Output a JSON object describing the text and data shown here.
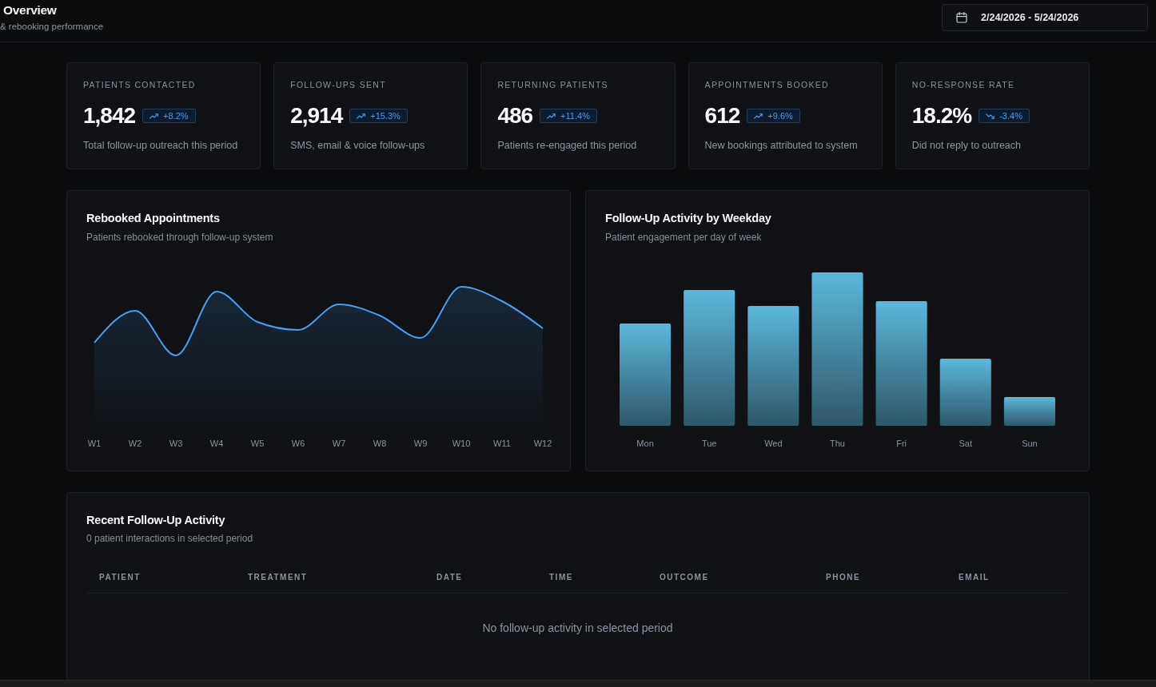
{
  "header": {
    "title": "Overview",
    "subtitle": "& rebooking performance",
    "date_range": "2/24/2026 - 5/24/2026"
  },
  "kpis": [
    {
      "label": "PATIENTS CONTACTED",
      "value": "1,842",
      "change": "+8.2%",
      "trend_up": true,
      "description": "Total follow-up outreach this period"
    },
    {
      "label": "FOLLOW-UPS SENT",
      "value": "2,914",
      "change": "+15.3%",
      "trend_up": true,
      "description": "SMS, email & voice follow-ups"
    },
    {
      "label": "RETURNING PATIENTS",
      "value": "486",
      "change": "+11.4%",
      "trend_up": true,
      "description": "Patients re-engaged this period"
    },
    {
      "label": "APPOINTMENTS BOOKED",
      "value": "612",
      "change": "+9.6%",
      "trend_up": true,
      "description": "New bookings attributed to system"
    },
    {
      "label": "NO-RESPONSE RATE",
      "value": "18.2%",
      "change": "-3.4%",
      "trend_up": false,
      "description": "Did not reply to outreach"
    }
  ],
  "charts": [
    {
      "kind": "area",
      "title": "Rebooked Appointments",
      "subtitle": "Patients rebooked through follow-up system",
      "axis_labels": [
        "W1",
        "W2",
        "W3",
        "W4",
        "W5",
        "W6",
        "W7",
        "W8",
        "W9",
        "W10",
        "W11",
        "W12"
      ]
    },
    {
      "kind": "bar",
      "title": "Follow-Up Activity by Weekday",
      "subtitle": "Patient engagement per day of week",
      "axis_labels": [
        "Mon",
        "Tue",
        "Wed",
        "Thu",
        "Fri",
        "Sat",
        "Sun"
      ]
    }
  ],
  "recent_activity": {
    "title": "Recent Follow-Up Activity",
    "subtitle": "0 patient interactions in selected period",
    "columns": [
      "PATIENT",
      "TREATMENT",
      "DATE",
      "TIME",
      "OUTCOME",
      "PHONE",
      "EMAIL"
    ],
    "empty_message": "No follow-up activity in selected period"
  }
}
